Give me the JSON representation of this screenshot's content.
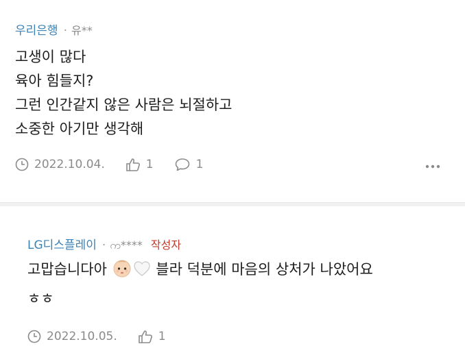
{
  "comment": {
    "company": "우리은행",
    "separator": "·",
    "nickname": "유**",
    "lines": "고생이 많다\n육아 힘들지?\n그런 인간같지 않은 사람은 뇌절하고\n소중한 아기만 생각해",
    "date": "2022.10.04.",
    "likes": "1",
    "replies": "1",
    "more_icon": "more-horizontal-icon"
  },
  "reply": {
    "company": "LG디스플레이",
    "separator": "·",
    "nickname": "က****",
    "author_tag": "작성자",
    "text_before": "고맙습니다아 ",
    "emoji_icons": [
      "baby-face-emoji",
      "white-heart-emoji"
    ],
    "text_after": " 블라 덕분에 마음의 상처가 나았어요",
    "text_line2": "ㅎㅎ",
    "date": "2022.10.05.",
    "likes": "1"
  },
  "colors": {
    "company": "#3b82b6",
    "author_tag": "#c0392b",
    "meta": "#8a8a8a",
    "divider": "#f1f1f1"
  }
}
